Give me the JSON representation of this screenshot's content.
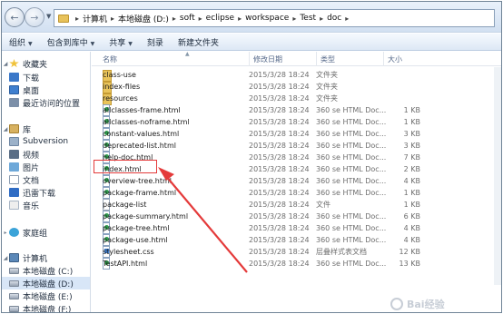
{
  "address": {
    "crumbs": [
      "计算机",
      "本地磁盘 (D:)",
      "soft",
      "eclipse",
      "workspace",
      "Test",
      "doc"
    ]
  },
  "toolbar": {
    "organize": "组织",
    "include_in_library": "包含到库中",
    "share": "共享",
    "burn": "刻录",
    "new_folder": "新建文件夹"
  },
  "sidebar": {
    "favorites": {
      "title": "收藏夹",
      "items": [
        "下载",
        "桌面",
        "最近访问的位置"
      ]
    },
    "libraries": {
      "title": "库",
      "items": [
        "Subversion",
        "视频",
        "图片",
        "文档",
        "迅雷下载",
        "音乐"
      ]
    },
    "homegroup": "家庭组",
    "computer": {
      "title": "计算机",
      "drives": [
        "本地磁盘 (C:)",
        "本地磁盘 (D:)",
        "本地磁盘 (E:)",
        "本地磁盘 (F:)"
      ]
    }
  },
  "columns": {
    "name": "名称",
    "date": "修改日期",
    "type": "类型",
    "size": "大小"
  },
  "files": [
    {
      "name": "class-use",
      "date": "2015/3/28 18:24",
      "type": "文件夹",
      "size": "",
      "icon": "folder"
    },
    {
      "name": "index-files",
      "date": "2015/3/28 18:24",
      "type": "文件夹",
      "size": "",
      "icon": "folder"
    },
    {
      "name": "resources",
      "date": "2015/3/28 18:24",
      "type": "文件夹",
      "size": "",
      "icon": "folder"
    },
    {
      "name": "allclasses-frame.html",
      "date": "2015/3/28 18:24",
      "type": "360 se HTML Doc...",
      "size": "1 KB",
      "icon": "html"
    },
    {
      "name": "allclasses-noframe.html",
      "date": "2015/3/28 18:24",
      "type": "360 se HTML Doc...",
      "size": "1 KB",
      "icon": "html"
    },
    {
      "name": "constant-values.html",
      "date": "2015/3/28 18:24",
      "type": "360 se HTML Doc...",
      "size": "3 KB",
      "icon": "html"
    },
    {
      "name": "deprecated-list.html",
      "date": "2015/3/28 18:24",
      "type": "360 se HTML Doc...",
      "size": "3 KB",
      "icon": "html"
    },
    {
      "name": "help-doc.html",
      "date": "2015/3/28 18:24",
      "type": "360 se HTML Doc...",
      "size": "7 KB",
      "icon": "html"
    },
    {
      "name": "index.html",
      "date": "2015/3/28 18:24",
      "type": "360 se HTML Doc...",
      "size": "2 KB",
      "icon": "html"
    },
    {
      "name": "overview-tree.html",
      "date": "2015/3/28 18:24",
      "type": "360 se HTML Doc...",
      "size": "4 KB",
      "icon": "html"
    },
    {
      "name": "package-frame.html",
      "date": "2015/3/28 18:24",
      "type": "360 se HTML Doc...",
      "size": "1 KB",
      "icon": "html"
    },
    {
      "name": "package-list",
      "date": "2015/3/28 18:24",
      "type": "文件",
      "size": "1 KB",
      "icon": "file"
    },
    {
      "name": "package-summary.html",
      "date": "2015/3/28 18:24",
      "type": "360 se HTML Doc...",
      "size": "6 KB",
      "icon": "html"
    },
    {
      "name": "package-tree.html",
      "date": "2015/3/28 18:24",
      "type": "360 se HTML Doc...",
      "size": "4 KB",
      "icon": "html"
    },
    {
      "name": "package-use.html",
      "date": "2015/3/28 18:24",
      "type": "360 se HTML Doc...",
      "size": "4 KB",
      "icon": "html"
    },
    {
      "name": "stylesheet.css",
      "date": "2015/3/28 18:24",
      "type": "层叠样式表文档",
      "size": "12 KB",
      "icon": "css"
    },
    {
      "name": "TestAPI.html",
      "date": "2015/3/28 18:24",
      "type": "360 se HTML Doc...",
      "size": "13 KB",
      "icon": "html"
    }
  ],
  "watermark": "Bai经验",
  "colors": {
    "highlight": "#e43a3a",
    "arrow": "#e43a3a",
    "selection": "#d8e6f7"
  }
}
